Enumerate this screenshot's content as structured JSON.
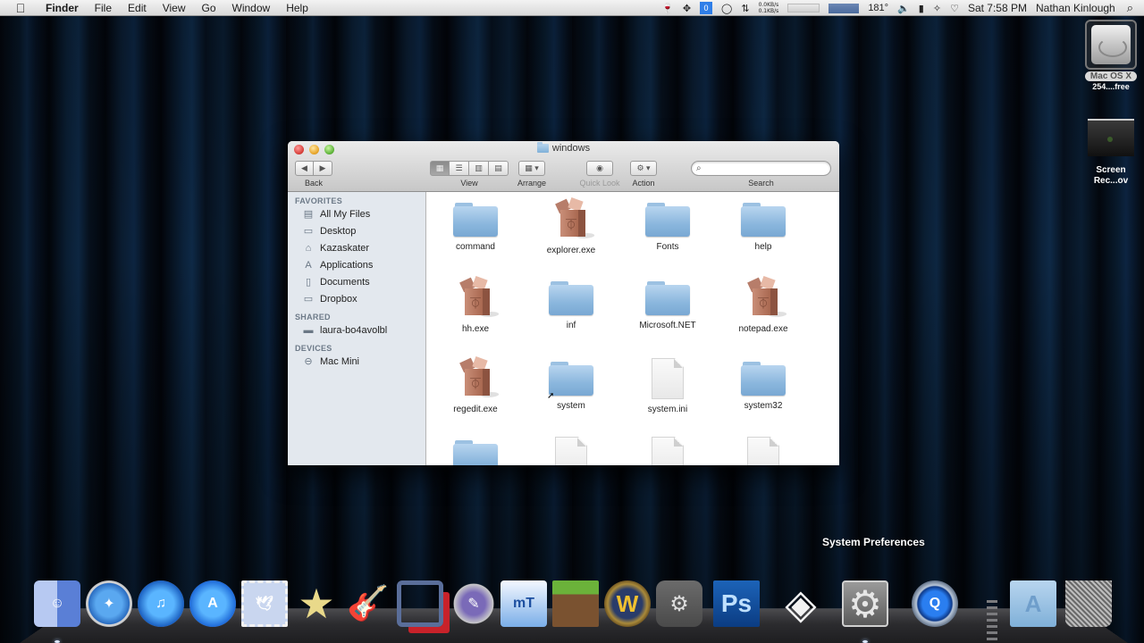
{
  "menubar": {
    "app_name": "Finder",
    "menus": [
      "File",
      "Edit",
      "View",
      "Go",
      "Window",
      "Help"
    ],
    "status": {
      "badge_count": "0",
      "net_down": "0.0KB/s",
      "net_up": "0.1KB/s",
      "temperature": "181°",
      "clock": "Sat 7:58 PM",
      "user": "Nathan Kinlough"
    }
  },
  "desktop_icons": [
    {
      "label": "Mac OS X",
      "sublabel": "254....free",
      "type": "hard-drive"
    },
    {
      "label": "Screen Rec...ov",
      "sublabel": "",
      "type": "movie"
    }
  ],
  "finder": {
    "title": "windows",
    "toolbar": {
      "back_label": "Back",
      "view_label": "View",
      "arrange_label": "Arrange",
      "quicklook_label": "Quick Look",
      "action_label": "Action",
      "search_label": "Search",
      "search_value": "",
      "search_placeholder": "",
      "active_view": "icon"
    },
    "sidebar": {
      "sections": [
        {
          "title": "FAVORITES",
          "items": [
            {
              "label": "All My Files",
              "icon": "all-files-icon",
              "glyph": "▤"
            },
            {
              "label": "Desktop",
              "icon": "desktop-icon",
              "glyph": "▭"
            },
            {
              "label": "Kazaskater",
              "icon": "home-icon",
              "glyph": "⌂"
            },
            {
              "label": "Applications",
              "icon": "applications-icon",
              "glyph": "A"
            },
            {
              "label": "Documents",
              "icon": "documents-icon",
              "glyph": "▯"
            },
            {
              "label": "Dropbox",
              "icon": "folder-icon",
              "glyph": "▭"
            }
          ]
        },
        {
          "title": "SHARED",
          "items": [
            {
              "label": "laura-bo4avolbl",
              "icon": "computer-icon",
              "glyph": "▬"
            }
          ]
        },
        {
          "title": "DEVICES",
          "items": [
            {
              "label": "Mac Mini",
              "icon": "mac-mini-icon",
              "glyph": "⊖"
            }
          ]
        }
      ]
    },
    "files": [
      {
        "name": "command",
        "kind": "folder"
      },
      {
        "name": "explorer.exe",
        "kind": "exe"
      },
      {
        "name": "Fonts",
        "kind": "folder"
      },
      {
        "name": "help",
        "kind": "folder"
      },
      {
        "name": "hh.exe",
        "kind": "exe"
      },
      {
        "name": "inf",
        "kind": "folder"
      },
      {
        "name": "Microsoft.NET",
        "kind": "folder"
      },
      {
        "name": "notepad.exe",
        "kind": "exe"
      },
      {
        "name": "regedit.exe",
        "kind": "exe"
      },
      {
        "name": "system",
        "kind": "folder-alias"
      },
      {
        "name": "system.ini",
        "kind": "document"
      },
      {
        "name": "system32",
        "kind": "folder"
      },
      {
        "name": "",
        "kind": "folder"
      },
      {
        "name": "",
        "kind": "document"
      },
      {
        "name": "",
        "kind": "document"
      },
      {
        "name": "",
        "kind": "document"
      }
    ]
  },
  "dock": {
    "tooltip": "System Preferences",
    "items": [
      {
        "name": "Finder",
        "icon": "finder-icon",
        "running": true
      },
      {
        "name": "Safari",
        "icon": "safari-icon",
        "running": false
      },
      {
        "name": "iTunes",
        "icon": "itunes-icon",
        "running": false
      },
      {
        "name": "App Store",
        "icon": "app-store-icon",
        "running": false
      },
      {
        "name": "Mail",
        "icon": "mail-icon",
        "running": false
      },
      {
        "name": "iMovie",
        "icon": "imovie-icon",
        "running": false
      },
      {
        "name": "GarageBand",
        "icon": "garageband-icon",
        "running": false
      },
      {
        "name": "VMware Fusion",
        "icon": "vmware-icon",
        "running": false
      },
      {
        "name": "Script Editor",
        "icon": "script-editor-icon",
        "running": false
      },
      {
        "name": "MacTubes",
        "icon": "mactubes-icon",
        "running": false
      },
      {
        "name": "Minecraft",
        "icon": "minecraft-icon",
        "running": false
      },
      {
        "name": "World of Warcraft",
        "icon": "wow-icon",
        "running": false
      },
      {
        "name": "Steam",
        "icon": "steam-icon",
        "running": false
      },
      {
        "name": "Photoshop",
        "icon": "photoshop-icon",
        "running": false,
        "glyph": "Ps"
      },
      {
        "name": "Unity",
        "icon": "unity-icon",
        "running": false
      },
      {
        "name": "System Preferences",
        "icon": "system-preferences-icon",
        "running": true
      },
      {
        "name": "QuickTime Player",
        "icon": "quicktime-icon",
        "running": false
      },
      {
        "name": "Applications",
        "icon": "applications-folder-icon",
        "running": false
      },
      {
        "name": "Trash",
        "icon": "trash-icon",
        "running": false
      }
    ]
  }
}
